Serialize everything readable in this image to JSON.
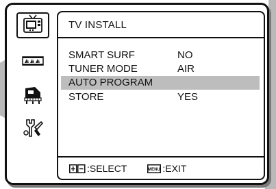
{
  "menu": {
    "title": "TV INSTALL",
    "items": [
      {
        "label": "SMART SURF",
        "value": "NO",
        "highlighted": false
      },
      {
        "label": "TUNER MODE",
        "value": "AIR",
        "highlighted": false
      },
      {
        "label": "AUTO PROGRAM",
        "value": "",
        "highlighted": true
      },
      {
        "label": "STORE",
        "value": "YES",
        "highlighted": false
      }
    ]
  },
  "sidebar": {
    "icons": [
      {
        "name": "tv-icon",
        "selected": true
      },
      {
        "name": "film-strip-icon",
        "selected": false
      },
      {
        "name": "piano-icon",
        "selected": false
      },
      {
        "name": "tools-icon",
        "selected": false
      }
    ]
  },
  "footer": {
    "select_label": ":SELECT",
    "exit_label": ":EXIT",
    "select_icon": "up-down-key-icon",
    "exit_icon": "menu-key-icon",
    "exit_icon_text": "MENU"
  },
  "colors": {
    "highlight": "#bdbdbd",
    "frame": "#111111",
    "background_shape": "#b9b9b9"
  }
}
